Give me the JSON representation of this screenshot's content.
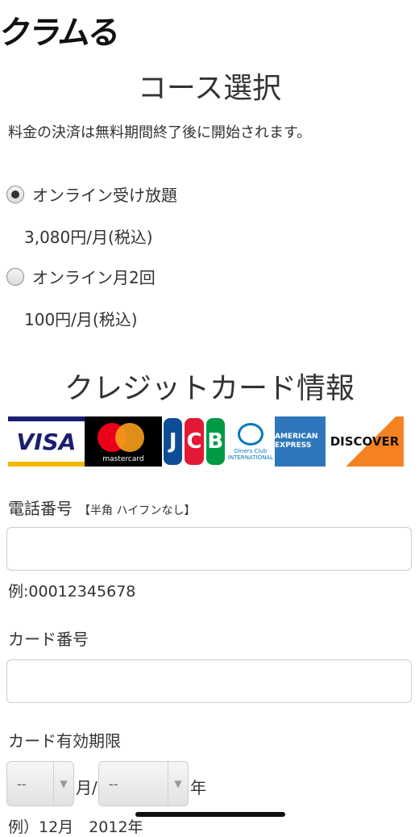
{
  "header": {
    "logo_text": "クラムる"
  },
  "course": {
    "title": "コース選択",
    "note": "料金の決済は無料期間終了後に開始されます。",
    "options": [
      {
        "label": "オンライン受け放題",
        "price": "3,080円/月(税込)",
        "selected": true
      },
      {
        "label": "オンライン月2回",
        "price": "100円/月(税込)",
        "selected": false
      }
    ]
  },
  "card_section": {
    "title": "クレジットカード情報",
    "brands": [
      "VISA",
      "mastercard",
      "JCB",
      "Diners Club",
      "AMERICAN EXPRESS",
      "DISCOVER"
    ],
    "diners_sub": "INTERNATIONAL"
  },
  "form": {
    "phone_label": "電話番号",
    "phone_hint": "【半角 ハイフンなし】",
    "phone_value": "",
    "phone_example": "例:00012345678",
    "card_number_label": "カード番号",
    "card_number_value": "",
    "expiry_label": "カード有効期限",
    "month_value": "--",
    "month_unit": "月/",
    "year_value": "--",
    "year_unit": "年",
    "expiry_example": "例）12月　2012年"
  }
}
